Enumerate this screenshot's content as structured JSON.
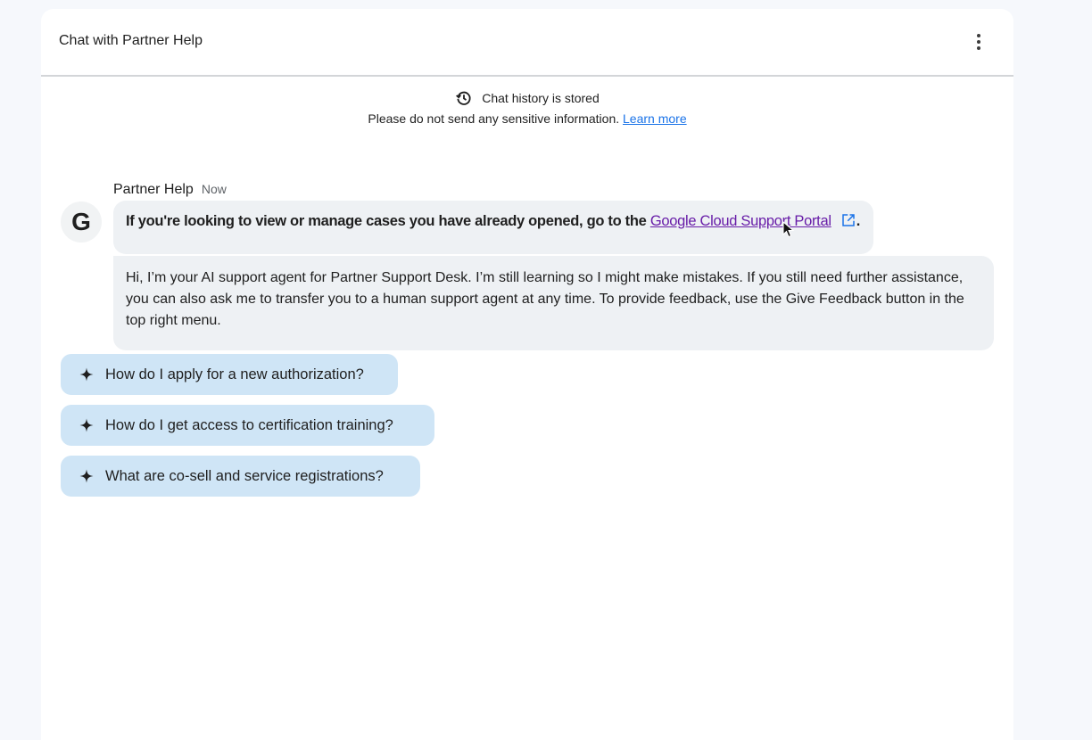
{
  "header": {
    "title": "Chat with Partner Help",
    "menu_icon": "more-vert-icon"
  },
  "notice": {
    "icon": "history-icon",
    "title": "Chat history is stored",
    "text": "Please do not send any sensitive information.",
    "link": "Learn more"
  },
  "message": {
    "sender": "Partner Help",
    "time": "Now",
    "avatar_letter": "G",
    "intro_prefix": "If you're looking to view or manage cases you have already opened, go to the",
    "intro_link": "Google Cloud Support Portal",
    "intro_suffix": ".",
    "body": "Hi, I’m your AI support agent for Partner Support Desk. I’m still learning so I might make mistakes. If you still need further assistance, you can also ask me to transfer you to a human support agent at any time. To provide feedback, use the Give Feedback button in the top right menu."
  },
  "suggestions": [
    {
      "icon": "sparkle-icon",
      "label": "How do I apply for a new authorization?"
    },
    {
      "icon": "sparkle-icon",
      "label": "How do I get access to certification training?"
    },
    {
      "icon": "sparkle-icon",
      "label": "What are co-sell and service registrations?"
    }
  ],
  "colors": {
    "link": "#1a73e8",
    "visited_link": "#681da8",
    "chip_bg": "#cfe5f6",
    "bubble_bg": "#eef1f4"
  }
}
